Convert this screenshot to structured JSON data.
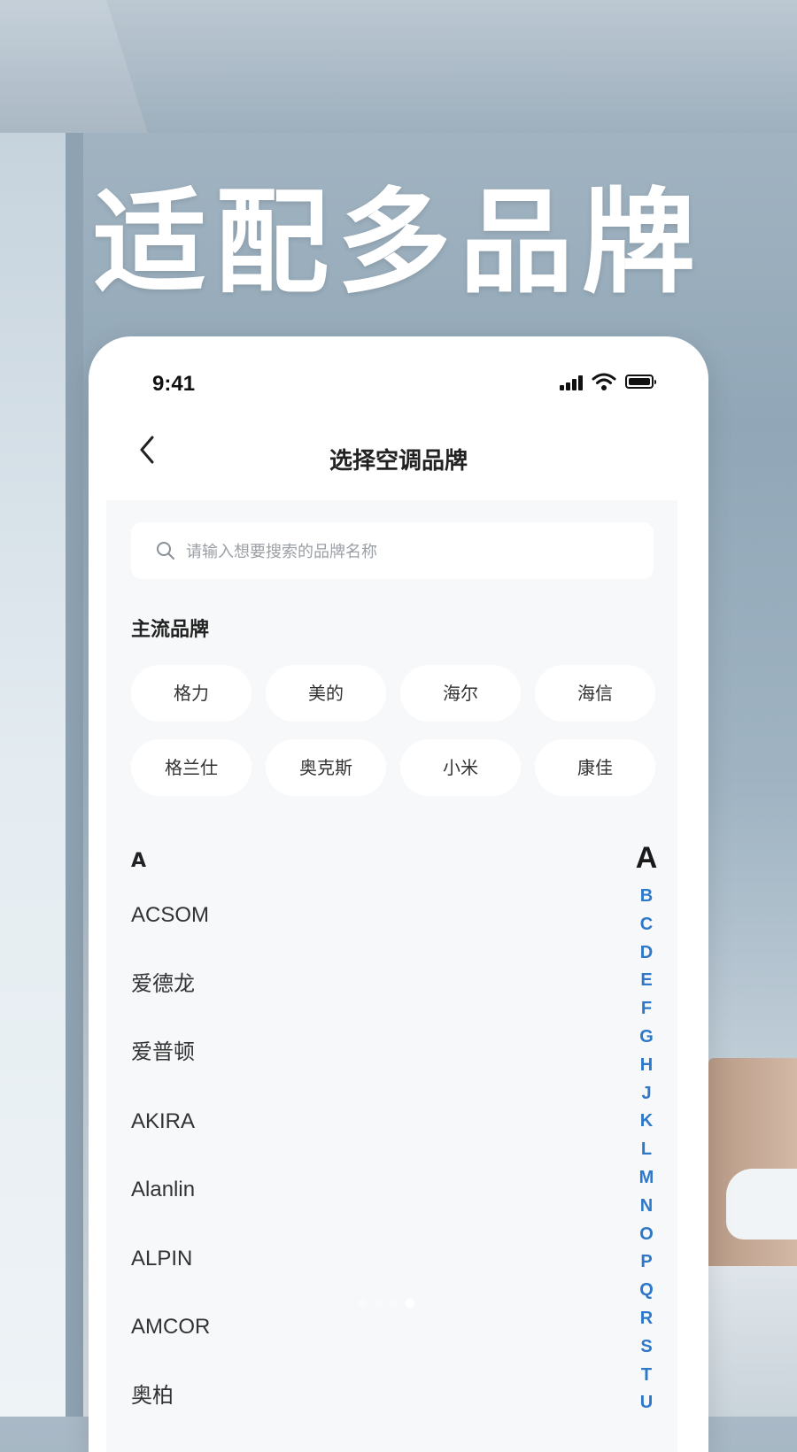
{
  "headline": "适配多品牌",
  "status_bar": {
    "time": "9:41"
  },
  "nav": {
    "title": "选择空调品牌"
  },
  "search": {
    "placeholder": "请输入想要搜索的品牌名称"
  },
  "main_brands": {
    "title": "主流品牌",
    "items": [
      "格力",
      "美的",
      "海尔",
      "海信",
      "格兰仕",
      "奥克斯",
      "小米",
      "康佳"
    ]
  },
  "brand_list": {
    "current_letter": "A",
    "items": [
      "ACSOM",
      "爱德龙",
      "爱普顿",
      "AKIRA",
      "Alanlin",
      "ALPIN",
      "AMCOR",
      "奥柏"
    ]
  },
  "index_bar": {
    "active": "A",
    "letters": [
      "B",
      "C",
      "D",
      "E",
      "F",
      "G",
      "H",
      "J",
      "K",
      "L",
      "M",
      "N",
      "O",
      "P",
      "Q",
      "R",
      "S",
      "T",
      "U"
    ]
  },
  "colors": {
    "index_letter": "#2d78c8",
    "card_bg": "#ffffff",
    "content_bg": "#f6f8fa"
  }
}
